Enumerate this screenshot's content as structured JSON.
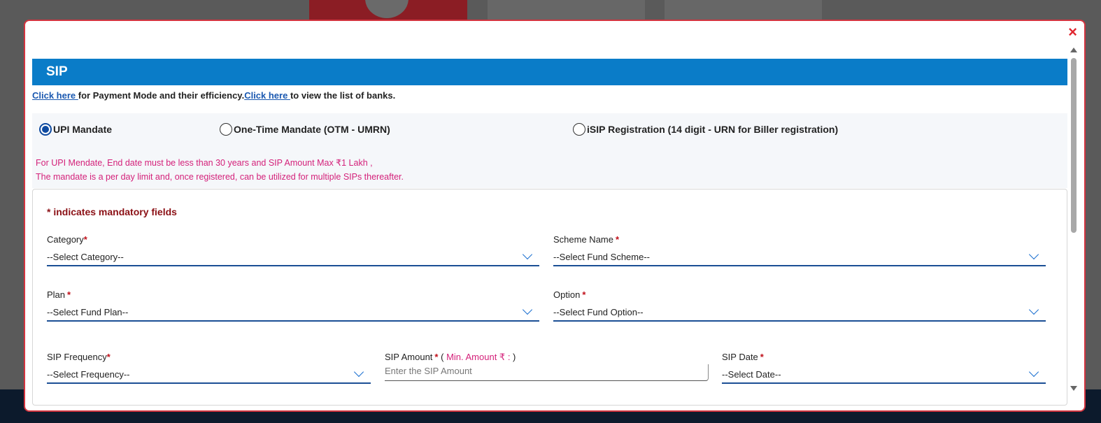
{
  "modal": {
    "close_glyph": "×",
    "title": "SIP"
  },
  "links": {
    "link1": "Click here ",
    "text1": "for Payment Mode and their efficiency.",
    "link2": "Click here ",
    "text2": "to view the list of banks."
  },
  "mandate": {
    "options": [
      {
        "label": "UPI Mandate",
        "selected": true
      },
      {
        "label": "One-Time Mandate (OTM - UMRN)",
        "selected": false
      },
      {
        "label": "iSIP Registration (14 digit - URN for Biller registration)",
        "selected": false
      }
    ],
    "note_line1": "For UPI Mendate, End date must be less than 30 years and SIP Amount Max ₹1 Lakh ,",
    "note_line2": "The mandate is a per day limit and, once registered, can be utilized for multiple SIPs thereafter."
  },
  "form": {
    "mandatory_note": "* indicates mandatory fields",
    "star": "*",
    "category": {
      "label": "Category",
      "value": "--Select Category--"
    },
    "scheme": {
      "label": "Scheme Name",
      "value": "--Select Fund Scheme--"
    },
    "plan": {
      "label": "Plan",
      "value": "--Select Fund Plan--"
    },
    "option": {
      "label": "Option",
      "value": "--Select Fund Option--"
    },
    "frequency": {
      "label": "SIP Frequency",
      "value": "--Select Frequency--"
    },
    "amount": {
      "label": "SIP Amount",
      "paren_open": "( ",
      "min_label": "Min. Amount ₹ : ",
      "paren_close": ")",
      "placeholder": "Enter the SIP Amount"
    },
    "date": {
      "label": "SIP Date",
      "value": "--Select Date--"
    }
  },
  "colors": {
    "header_blue": "#0a7cc8",
    "modal_border": "#d3343f",
    "note_pink": "#d4217a",
    "mandatory_red": "#8b1015"
  }
}
